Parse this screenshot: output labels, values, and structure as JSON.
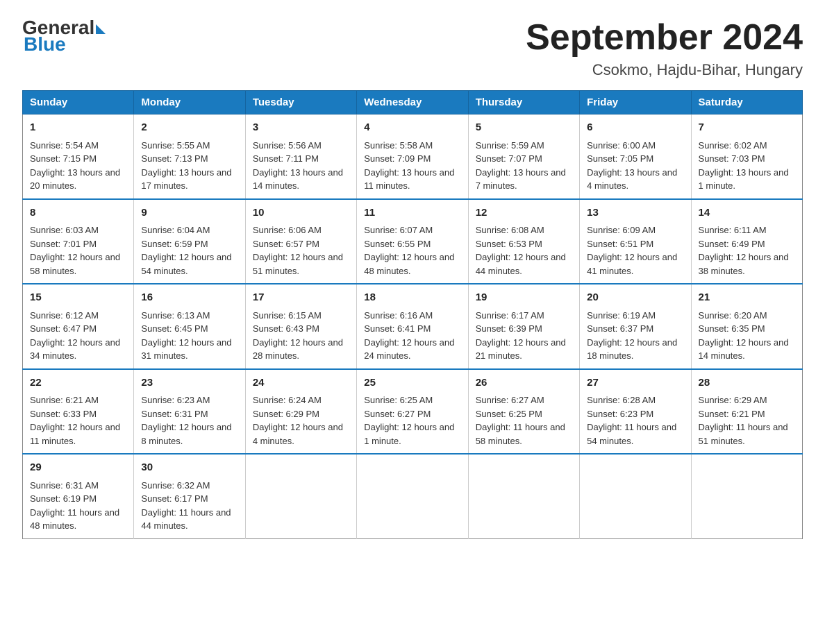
{
  "logo": {
    "general": "General",
    "blue": "Blue"
  },
  "title": "September 2024",
  "subtitle": "Csokmo, Hajdu-Bihar, Hungary",
  "days_of_week": [
    "Sunday",
    "Monday",
    "Tuesday",
    "Wednesday",
    "Thursday",
    "Friday",
    "Saturday"
  ],
  "weeks": [
    [
      {
        "day": "1",
        "sunrise": "Sunrise: 5:54 AM",
        "sunset": "Sunset: 7:15 PM",
        "daylight": "Daylight: 13 hours and 20 minutes."
      },
      {
        "day": "2",
        "sunrise": "Sunrise: 5:55 AM",
        "sunset": "Sunset: 7:13 PM",
        "daylight": "Daylight: 13 hours and 17 minutes."
      },
      {
        "day": "3",
        "sunrise": "Sunrise: 5:56 AM",
        "sunset": "Sunset: 7:11 PM",
        "daylight": "Daylight: 13 hours and 14 minutes."
      },
      {
        "day": "4",
        "sunrise": "Sunrise: 5:58 AM",
        "sunset": "Sunset: 7:09 PM",
        "daylight": "Daylight: 13 hours and 11 minutes."
      },
      {
        "day": "5",
        "sunrise": "Sunrise: 5:59 AM",
        "sunset": "Sunset: 7:07 PM",
        "daylight": "Daylight: 13 hours and 7 minutes."
      },
      {
        "day": "6",
        "sunrise": "Sunrise: 6:00 AM",
        "sunset": "Sunset: 7:05 PM",
        "daylight": "Daylight: 13 hours and 4 minutes."
      },
      {
        "day": "7",
        "sunrise": "Sunrise: 6:02 AM",
        "sunset": "Sunset: 7:03 PM",
        "daylight": "Daylight: 13 hours and 1 minute."
      }
    ],
    [
      {
        "day": "8",
        "sunrise": "Sunrise: 6:03 AM",
        "sunset": "Sunset: 7:01 PM",
        "daylight": "Daylight: 12 hours and 58 minutes."
      },
      {
        "day": "9",
        "sunrise": "Sunrise: 6:04 AM",
        "sunset": "Sunset: 6:59 PM",
        "daylight": "Daylight: 12 hours and 54 minutes."
      },
      {
        "day": "10",
        "sunrise": "Sunrise: 6:06 AM",
        "sunset": "Sunset: 6:57 PM",
        "daylight": "Daylight: 12 hours and 51 minutes."
      },
      {
        "day": "11",
        "sunrise": "Sunrise: 6:07 AM",
        "sunset": "Sunset: 6:55 PM",
        "daylight": "Daylight: 12 hours and 48 minutes."
      },
      {
        "day": "12",
        "sunrise": "Sunrise: 6:08 AM",
        "sunset": "Sunset: 6:53 PM",
        "daylight": "Daylight: 12 hours and 44 minutes."
      },
      {
        "day": "13",
        "sunrise": "Sunrise: 6:09 AM",
        "sunset": "Sunset: 6:51 PM",
        "daylight": "Daylight: 12 hours and 41 minutes."
      },
      {
        "day": "14",
        "sunrise": "Sunrise: 6:11 AM",
        "sunset": "Sunset: 6:49 PM",
        "daylight": "Daylight: 12 hours and 38 minutes."
      }
    ],
    [
      {
        "day": "15",
        "sunrise": "Sunrise: 6:12 AM",
        "sunset": "Sunset: 6:47 PM",
        "daylight": "Daylight: 12 hours and 34 minutes."
      },
      {
        "day": "16",
        "sunrise": "Sunrise: 6:13 AM",
        "sunset": "Sunset: 6:45 PM",
        "daylight": "Daylight: 12 hours and 31 minutes."
      },
      {
        "day": "17",
        "sunrise": "Sunrise: 6:15 AM",
        "sunset": "Sunset: 6:43 PM",
        "daylight": "Daylight: 12 hours and 28 minutes."
      },
      {
        "day": "18",
        "sunrise": "Sunrise: 6:16 AM",
        "sunset": "Sunset: 6:41 PM",
        "daylight": "Daylight: 12 hours and 24 minutes."
      },
      {
        "day": "19",
        "sunrise": "Sunrise: 6:17 AM",
        "sunset": "Sunset: 6:39 PM",
        "daylight": "Daylight: 12 hours and 21 minutes."
      },
      {
        "day": "20",
        "sunrise": "Sunrise: 6:19 AM",
        "sunset": "Sunset: 6:37 PM",
        "daylight": "Daylight: 12 hours and 18 minutes."
      },
      {
        "day": "21",
        "sunrise": "Sunrise: 6:20 AM",
        "sunset": "Sunset: 6:35 PM",
        "daylight": "Daylight: 12 hours and 14 minutes."
      }
    ],
    [
      {
        "day": "22",
        "sunrise": "Sunrise: 6:21 AM",
        "sunset": "Sunset: 6:33 PM",
        "daylight": "Daylight: 12 hours and 11 minutes."
      },
      {
        "day": "23",
        "sunrise": "Sunrise: 6:23 AM",
        "sunset": "Sunset: 6:31 PM",
        "daylight": "Daylight: 12 hours and 8 minutes."
      },
      {
        "day": "24",
        "sunrise": "Sunrise: 6:24 AM",
        "sunset": "Sunset: 6:29 PM",
        "daylight": "Daylight: 12 hours and 4 minutes."
      },
      {
        "day": "25",
        "sunrise": "Sunrise: 6:25 AM",
        "sunset": "Sunset: 6:27 PM",
        "daylight": "Daylight: 12 hours and 1 minute."
      },
      {
        "day": "26",
        "sunrise": "Sunrise: 6:27 AM",
        "sunset": "Sunset: 6:25 PM",
        "daylight": "Daylight: 11 hours and 58 minutes."
      },
      {
        "day": "27",
        "sunrise": "Sunrise: 6:28 AM",
        "sunset": "Sunset: 6:23 PM",
        "daylight": "Daylight: 11 hours and 54 minutes."
      },
      {
        "day": "28",
        "sunrise": "Sunrise: 6:29 AM",
        "sunset": "Sunset: 6:21 PM",
        "daylight": "Daylight: 11 hours and 51 minutes."
      }
    ],
    [
      {
        "day": "29",
        "sunrise": "Sunrise: 6:31 AM",
        "sunset": "Sunset: 6:19 PM",
        "daylight": "Daylight: 11 hours and 48 minutes."
      },
      {
        "day": "30",
        "sunrise": "Sunrise: 6:32 AM",
        "sunset": "Sunset: 6:17 PM",
        "daylight": "Daylight: 11 hours and 44 minutes."
      },
      null,
      null,
      null,
      null,
      null
    ]
  ]
}
